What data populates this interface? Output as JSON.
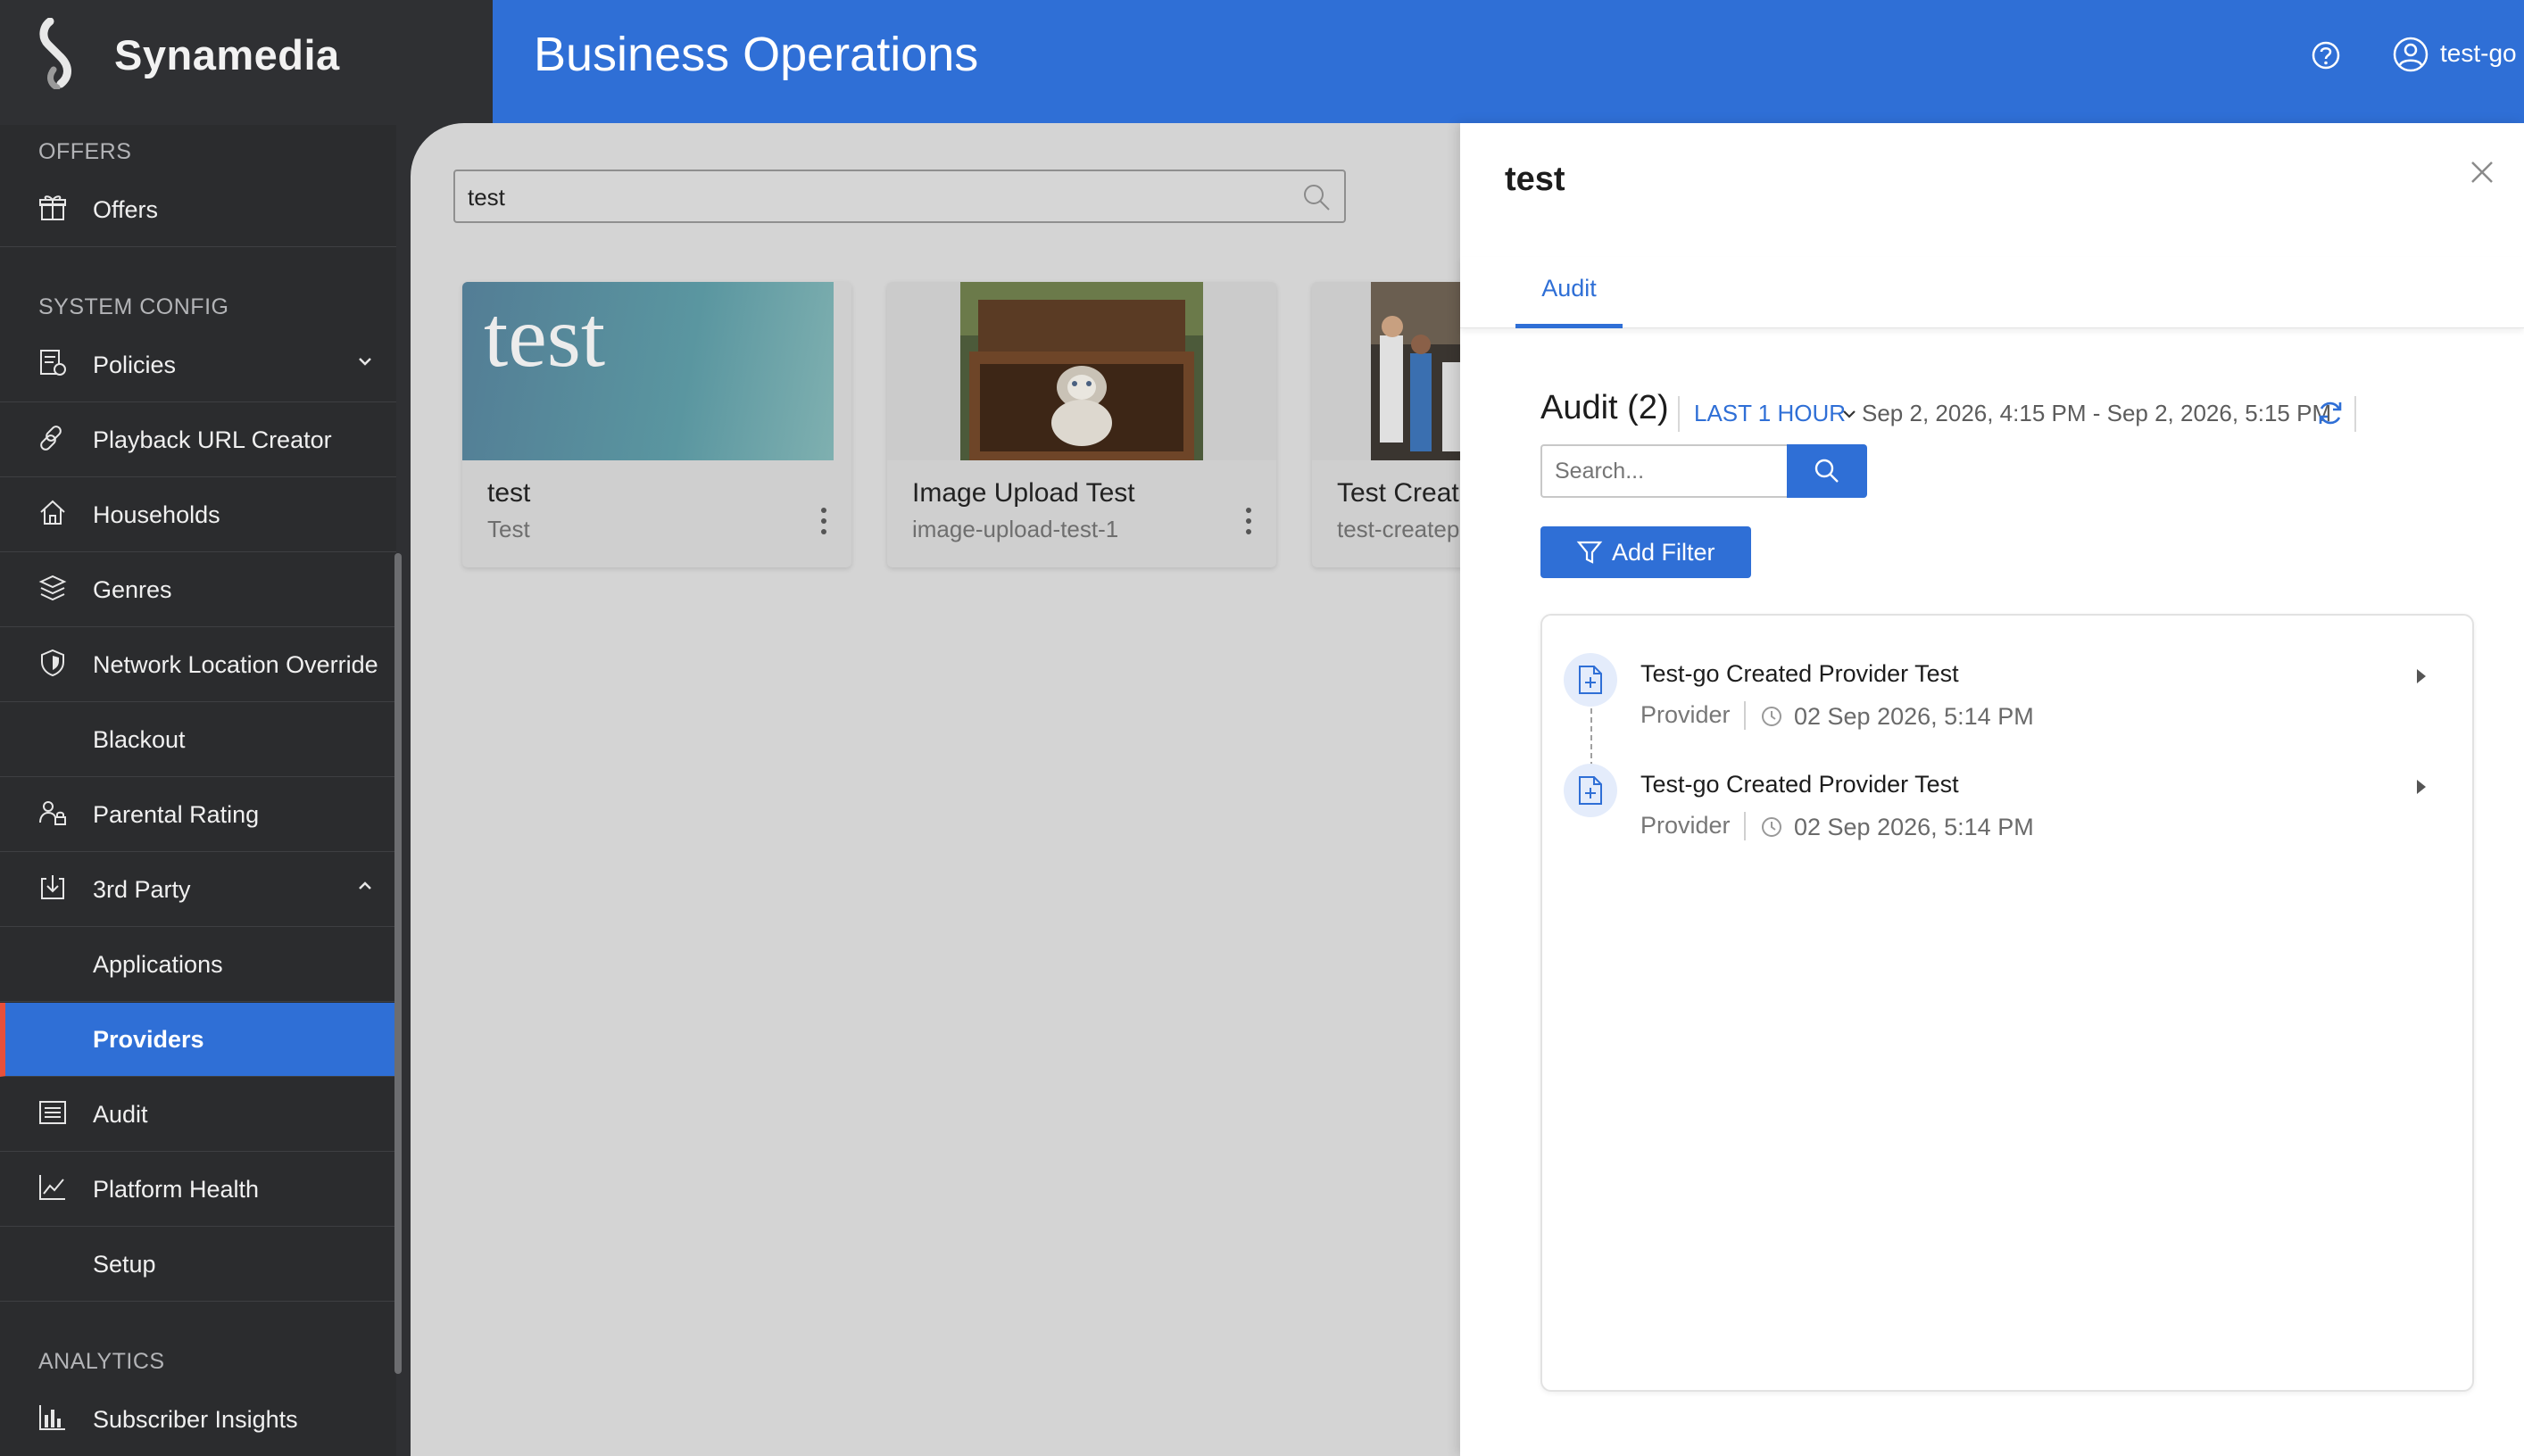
{
  "brand": {
    "name": "Synamedia"
  },
  "header": {
    "title": "Business Operations",
    "user": "test-go"
  },
  "sidebar": {
    "sections": [
      {
        "title": "OFFERS"
      },
      {
        "title": "SYSTEM CONFIG"
      },
      {
        "title": "ANALYTICS"
      }
    ],
    "items": [
      {
        "label": "Offers",
        "icon": "gift-icon"
      },
      {
        "label": "Policies",
        "icon": "policies-icon"
      },
      {
        "label": "Playback URL Creator",
        "icon": "link-icon"
      },
      {
        "label": "Households",
        "icon": "home-icon"
      },
      {
        "label": "Genres",
        "icon": "layers-icon"
      },
      {
        "label": "Network Location Override",
        "icon": "shield-icon"
      },
      {
        "label": "Blackout",
        "icon": ""
      },
      {
        "label": "Parental Rating",
        "icon": "parental-icon"
      },
      {
        "label": "3rd Party",
        "icon": "download-icon"
      },
      {
        "label": "Applications",
        "icon": ""
      },
      {
        "label": "Providers",
        "icon": ""
      },
      {
        "label": "Audit",
        "icon": "list-icon"
      },
      {
        "label": "Platform Health",
        "icon": "chart-icon"
      },
      {
        "label": "Setup",
        "icon": ""
      },
      {
        "label": "Subscriber Insights",
        "icon": "bar-chart-icon"
      }
    ],
    "active": "Providers"
  },
  "main": {
    "search_value": "test",
    "cards": [
      {
        "title": "test",
        "subtitle": "Test",
        "thumb_text": "test"
      },
      {
        "title": "Image Upload Test",
        "subtitle": "image-upload-test-1"
      },
      {
        "title": "Test Create",
        "subtitle": "test-createp"
      }
    ]
  },
  "drawer": {
    "title": "test",
    "tab": "Audit",
    "audit_heading": "Audit (2)",
    "range_label": "LAST 1 HOUR",
    "range_text": "Sep 2, 2026, 4:15 PM - Sep 2, 2026, 5:15 PM",
    "search_placeholder": "Search...",
    "add_filter": "Add Filter",
    "entries": [
      {
        "title": "Test-go Created Provider Test",
        "type": "Provider",
        "time": "02 Sep 2026, 5:14 PM"
      },
      {
        "title": "Test-go Created Provider Test",
        "type": "Provider",
        "time": "02 Sep 2026, 5:14 PM"
      }
    ]
  },
  "colors": {
    "accent": "#2f6fd6",
    "sidebar_bg": "#2b2c2e",
    "active_marker": "#e8503a"
  }
}
